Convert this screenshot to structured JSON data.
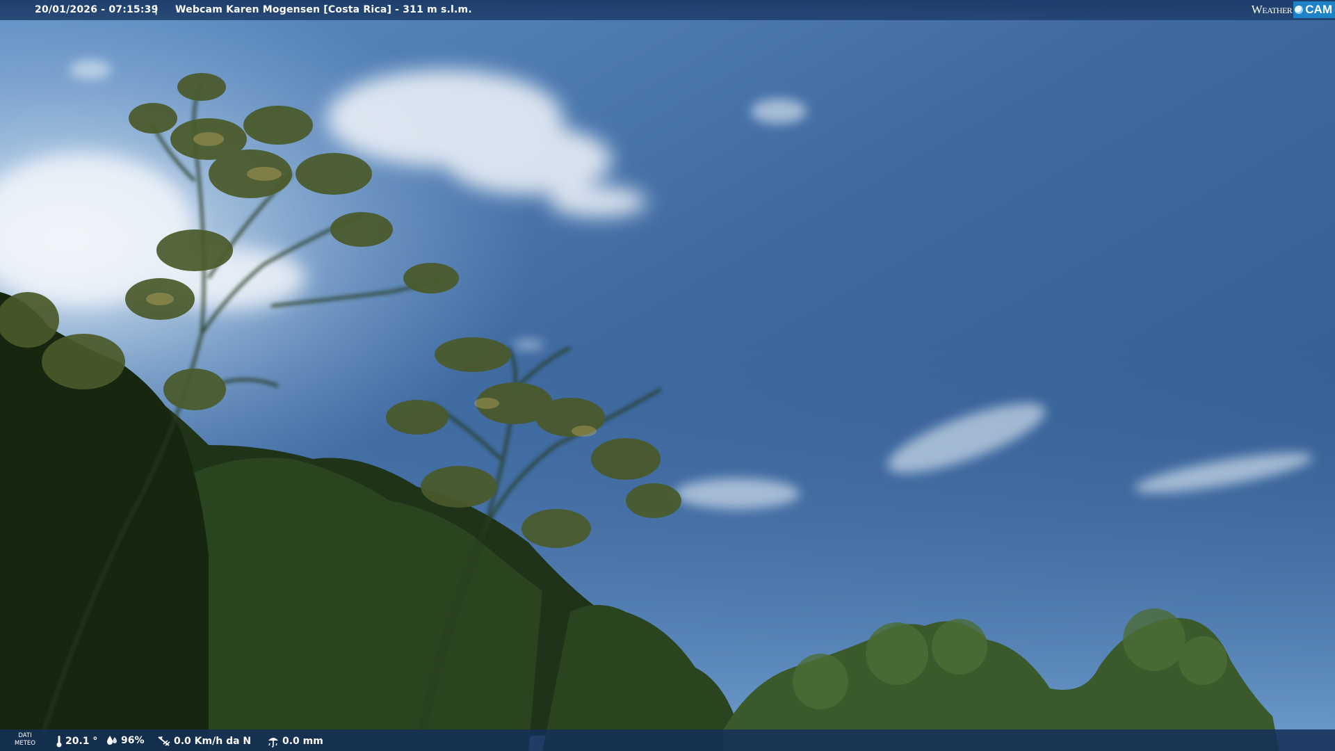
{
  "header": {
    "datetime": "20/01/2026 - 07:15:39",
    "separator": "|",
    "location": "Webcam Karen Mogensen [Costa Rica] - 311 m s.l.m."
  },
  "brand": {
    "weather": "Weather",
    "cam": "CAM"
  },
  "footer": {
    "dati_line1": "DATI",
    "dati_line2": "METEO",
    "temperature": "20.1 °",
    "humidity": "96%",
    "wind": "0.0 Km/h da N",
    "rain": "0.0 mm"
  },
  "colors": {
    "sky_top": "#355f93",
    "sky_bottom": "#6f9ed0",
    "bar": "#1c3a68",
    "brand_accent": "#1d82c8"
  },
  "icons": {
    "temperature": "thermometer-icon",
    "humidity": "humidity-drop-icon",
    "wind": "wind-vane-icon",
    "rain": "rain-gauge-icon"
  }
}
